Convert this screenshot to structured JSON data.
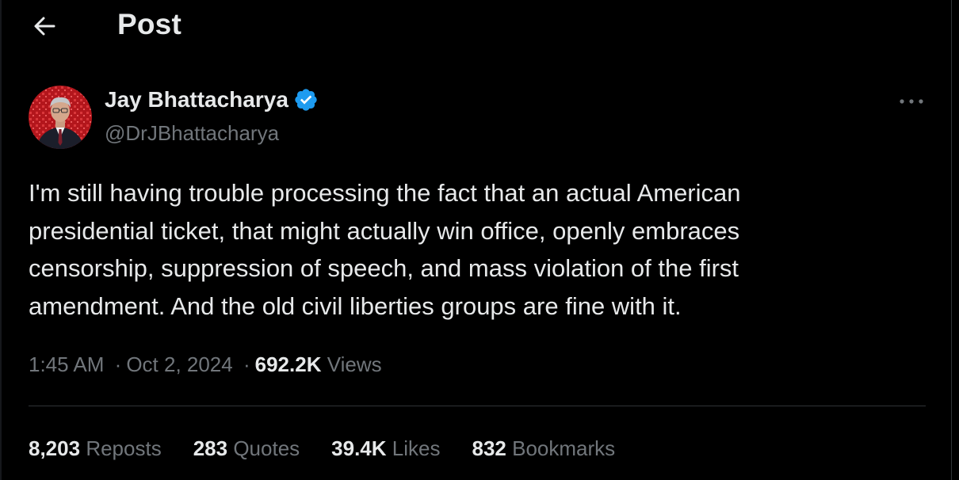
{
  "header": {
    "title": "Post",
    "back_icon": "arrow-left-icon"
  },
  "author": {
    "display_name": "Jay Bhattacharya",
    "handle": "@DrJBhattacharya",
    "verified": true,
    "verified_color": "#1d9bf0"
  },
  "more_icon": "more-horizontal-icon",
  "post": {
    "text": "I'm still having trouble processing the fact that an actual American\npresidential ticket, that might actually win office, openly embraces\ncensorship, suppression of speech, and mass violation of the first\namendment. And the old civil liberties groups are fine with it."
  },
  "meta": {
    "time": "1:45 AM",
    "date": "Oct 2, 2024",
    "separator": "·",
    "views_count": "692.2K",
    "views_label": "Views"
  },
  "stats": {
    "reposts": {
      "count": "8,203",
      "label": "Reposts"
    },
    "quotes": {
      "count": "283",
      "label": "Quotes"
    },
    "likes": {
      "count": "39.4K",
      "label": "Likes"
    },
    "bookmarks": {
      "count": "832",
      "label": "Bookmarks"
    }
  },
  "colors": {
    "background": "#000000",
    "text_primary": "#e7e9ea",
    "text_secondary": "#71767b",
    "divider": "#2f3336"
  }
}
